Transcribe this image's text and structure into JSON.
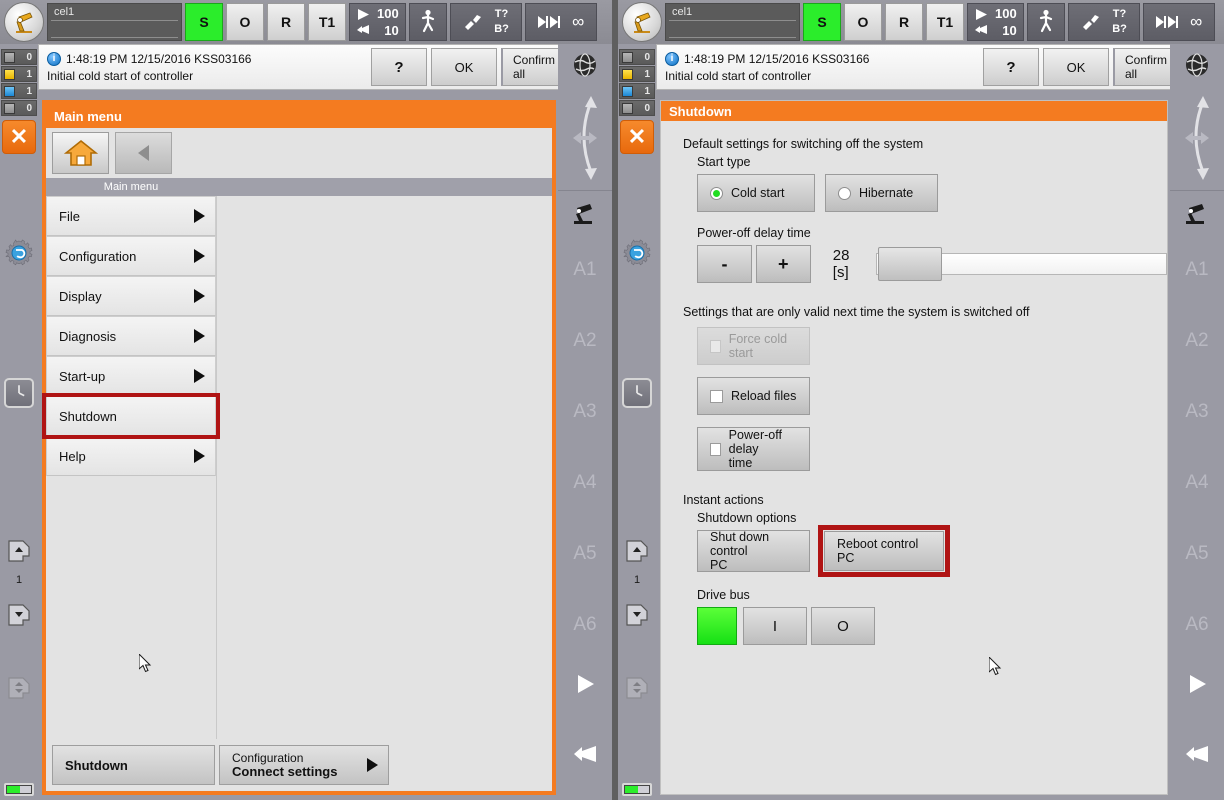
{
  "topbar": {
    "robot_name": "cel1",
    "robot_name2": "",
    "buttons": [
      {
        "label": "S",
        "name": "submit-interpreter-status"
      },
      {
        "label": "O",
        "name": "drives-status"
      },
      {
        "label": "R",
        "name": "robot-interpreter-status"
      },
      {
        "label": "T1",
        "name": "operating-mode"
      }
    ],
    "override_program": "100",
    "override_jog": "10",
    "tool_base": {
      "line1": "T?",
      "line2": "B?"
    },
    "increment": "∞"
  },
  "message": {
    "timestamp": "1:48:19 PM 12/15/2016 KSS03166",
    "text": "Initial cold start of controller",
    "help_label": "?",
    "ok_label": "OK",
    "confirm_all_label": "Confirm all"
  },
  "status_counters": [
    {
      "type": "ack",
      "count": "0"
    },
    {
      "type": "warning",
      "count": "1"
    },
    {
      "type": "info",
      "count": "1"
    },
    {
      "type": "wait",
      "count": "0"
    }
  ],
  "left_rail": {
    "close_label": "✕",
    "marker_number": "1"
  },
  "right_rail": {
    "labels": [
      "A1",
      "A2",
      "A3",
      "A4",
      "A5",
      "A6"
    ]
  },
  "left_panel": {
    "frame_title": "Main menu",
    "column_header": "Main menu",
    "items": [
      {
        "label": "File",
        "has_arrow": true,
        "selected": false
      },
      {
        "label": "Configuration",
        "has_arrow": true,
        "selected": false
      },
      {
        "label": "Display",
        "has_arrow": true,
        "selected": false
      },
      {
        "label": "Diagnosis",
        "has_arrow": true,
        "selected": false
      },
      {
        "label": "Start-up",
        "has_arrow": true,
        "selected": false
      },
      {
        "label": "Shutdown",
        "has_arrow": false,
        "selected": true
      },
      {
        "label": "Help",
        "has_arrow": true,
        "selected": false
      }
    ],
    "footer": {
      "recent1": "Shutdown",
      "recent2_line1": "Configuration",
      "recent2_line2": "Connect settings"
    }
  },
  "right_panel": {
    "title": "Shutdown",
    "group_default": "Default settings for switching off the system",
    "start_type_label": "Start type",
    "start_type_options": [
      {
        "label": "Cold start",
        "selected": true
      },
      {
        "label": "Hibernate",
        "selected": false
      }
    ],
    "power_off_label": "Power-off delay time",
    "minus_label": "-",
    "plus_label": "+",
    "delay_value": "28 [s]",
    "group_next_time": "Settings that are only valid next time the system is switched off",
    "checkboxes": [
      {
        "label": "Force cold start",
        "checked": false,
        "disabled": true
      },
      {
        "label": "Reload files",
        "checked": false,
        "disabled": false
      },
      {
        "label_line1": "Power-off delay",
        "label_line2": "time",
        "checked": false,
        "disabled": false
      }
    ],
    "instant_actions_label": "Instant actions",
    "shutdown_options_label": "Shutdown options",
    "shutdown_pc_line1": "Shut down control",
    "shutdown_pc_line2": "PC",
    "reboot_pc_label": "Reboot control PC",
    "drive_bus_label": "Drive bus",
    "drive_on_label": "I",
    "drive_off_label": "O"
  },
  "colors": {
    "accent_orange": "#f47b20",
    "highlight_red": "#b01414",
    "status_green": "#2bed2b",
    "panel_gray": "#9a9aa4"
  }
}
